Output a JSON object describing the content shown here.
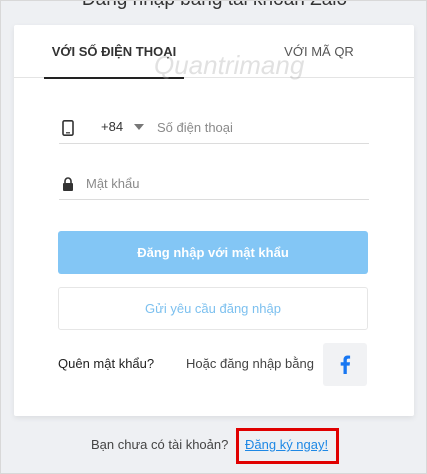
{
  "page": {
    "heading": "Đăng nhập bằng tài khoản Zalo"
  },
  "tabs": [
    {
      "label": "VỚI SỐ ĐIỆN THOẠI",
      "active": true
    },
    {
      "label": "VỚI MÃ QR",
      "active": false
    }
  ],
  "watermark": "Quantrimang",
  "phone": {
    "country_code": "+84",
    "placeholder": "Số điện thoại",
    "value": ""
  },
  "password": {
    "placeholder": "Mật khẩu",
    "value": ""
  },
  "buttons": {
    "login": "Đăng nhập với mật khẩu",
    "request": "Gửi yêu cầu đăng nhập",
    "facebook_icon": "facebook-icon"
  },
  "links": {
    "forgot_password": "Quên mật khẩu?",
    "or_login_with": "Hoặc đăng nhập bằng"
  },
  "footer": {
    "prompt": "Bạn chưa có tài khoản?",
    "signup": "Đăng ký ngay!"
  },
  "colors": {
    "login_button": "#83c6f5",
    "request_text": "#7cc0ef",
    "link": "#1e88e5",
    "facebook": "#1877f2",
    "highlight_box": "#e00000"
  }
}
